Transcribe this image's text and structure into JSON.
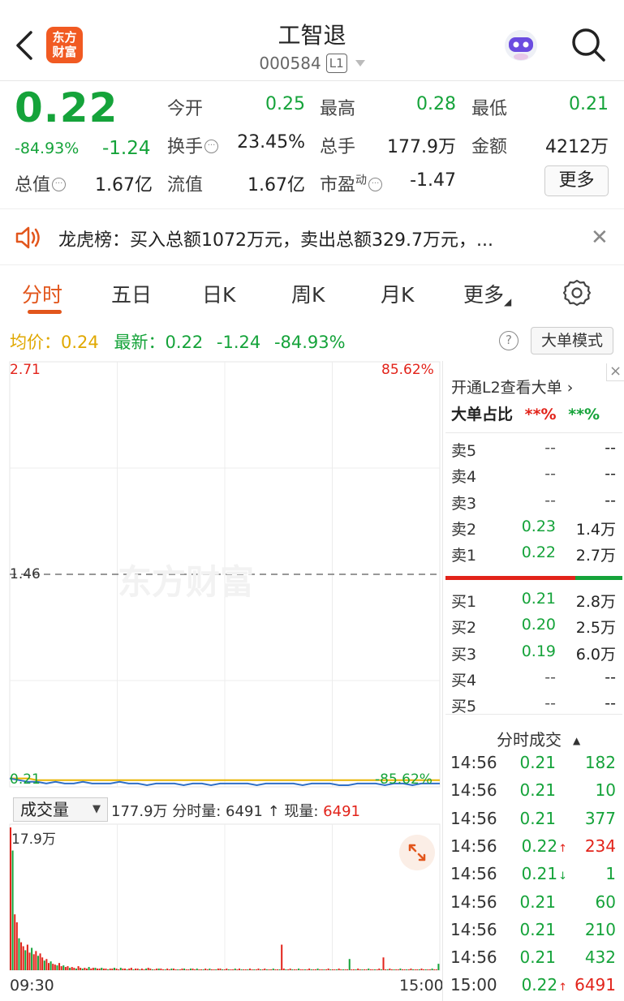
{
  "header": {
    "title": "工智退",
    "code": "000584",
    "level_badge": "L1",
    "logo_line1": "东方",
    "logo_line2": "财富"
  },
  "quote": {
    "price": "0.22",
    "pct": "-84.93%",
    "change": "-1.24",
    "fields": {
      "open_label": "今开",
      "open_value": "0.25",
      "high_label": "最高",
      "high_value": "0.28",
      "low_label": "最低",
      "low_value": "0.21",
      "turnover_label": "换手",
      "turnover_value": "23.45%",
      "volume_label": "总手",
      "volume_value": "177.9万",
      "amount_label": "金额",
      "amount_value": "4212万",
      "mktcap_label": "总值",
      "mktcap_value": "1.67亿",
      "float_label": "流值",
      "float_value": "1.67亿",
      "pe_label": "市盈",
      "pe_sup": "动",
      "pe_value": "-1.47"
    },
    "more_label": "更多"
  },
  "lhb": {
    "text": "龙虎榜：买入总额1072万元，卖出总额329.7万元，..."
  },
  "tabs": [
    "分时",
    "五日",
    "日K",
    "周K",
    "月K",
    "更多"
  ],
  "summary": {
    "avg_label": "均价：",
    "avg_value": "0.24",
    "latest_label": "最新：",
    "latest_value": "0.22",
    "latest_change": "-1.24",
    "latest_pct": "-84.93%",
    "help": "?",
    "mode_label": "大单模式"
  },
  "chart_data": {
    "type": "line",
    "y_max_label": "2.71",
    "y_mid_label": "1.46",
    "y_min_label": "0.21",
    "pct_max_label": "85.62%",
    "pct_min_label": "-85.62%",
    "x_start_label": "09:30",
    "x_end_label": "15:00",
    "ylim": [
      0.21,
      2.71
    ],
    "price": [
      0.25,
      0.24,
      0.23,
      0.23,
      0.22,
      0.23,
      0.22,
      0.22,
      0.23,
      0.22,
      0.22,
      0.22,
      0.23,
      0.22,
      0.22,
      0.21,
      0.22,
      0.22,
      0.22,
      0.21,
      0.22,
      0.22,
      0.21,
      0.22,
      0.22,
      0.22,
      0.22,
      0.21,
      0.22,
      0.22,
      0.22,
      0.22,
      0.21,
      0.22,
      0.22,
      0.22,
      0.21,
      0.21,
      0.22,
      0.22,
      0.22,
      0.21,
      0.22,
      0.22,
      0.21,
      0.22,
      0.22,
      0.22
    ],
    "avg": [
      0.25,
      0.25,
      0.25,
      0.24,
      0.24,
      0.24,
      0.24,
      0.24,
      0.24,
      0.24,
      0.24,
      0.24,
      0.24,
      0.24,
      0.24,
      0.24,
      0.24,
      0.24,
      0.24,
      0.24,
      0.24,
      0.24,
      0.24,
      0.24,
      0.24,
      0.24,
      0.24,
      0.24,
      0.24,
      0.24,
      0.24,
      0.24,
      0.24,
      0.24,
      0.24,
      0.24,
      0.24,
      0.24,
      0.24,
      0.24,
      0.24,
      0.24,
      0.24,
      0.24,
      0.24,
      0.24,
      0.24,
      0.24
    ],
    "volume_max_label": "17.9万",
    "volume": [
      17.9,
      15,
      7,
      6,
      4,
      3.5,
      3,
      2.5,
      3.2,
      2.2,
      2.8,
      2,
      2.4,
      1.8,
      2.1,
      1.6,
      1.2,
      1.4,
      0.9,
      1.1,
      0.8,
      0.7,
      0.6,
      0.9,
      0.5,
      0.6,
      0.4,
      0.5,
      0.3,
      0.4,
      0.3,
      0.2,
      0.5,
      0.3,
      0.2,
      0.3,
      0.2,
      0.4,
      0.2,
      0.3,
      0.3,
      0.2,
      0.2,
      0.3,
      0.2,
      0.2,
      0.1,
      0.2,
      0.2,
      0.3,
      0.2,
      0.1,
      0.3,
      0.2,
      0.2,
      0.1,
      0.2,
      0.3,
      0.1,
      0.2,
      0.2,
      0.1,
      0.2,
      0.1,
      0.2,
      0.3,
      0.2,
      0.1,
      0.1,
      0.2,
      0.2,
      0.2,
      0.1,
      0.1,
      0.2,
      0.1,
      0.2,
      0.2,
      0.1,
      0.1,
      0.1,
      0.2,
      0.2,
      0.1,
      0.1,
      0.2,
      0.2,
      0.1,
      0.2,
      0.1,
      0.1,
      0.1,
      0.2,
      0.1,
      0.2,
      0.1,
      0.1,
      0.1,
      0.2,
      0.2,
      0.1,
      0.1,
      0.2,
      0.1,
      0.1,
      0.1,
      0.2,
      0.1,
      0.2,
      0.1,
      0.1,
      0.1,
      0.1,
      0.2,
      0.1,
      0.1,
      0.1,
      0.2,
      0.1,
      0.1,
      0.2,
      0.1,
      0.1,
      0.1,
      0.2,
      0.1,
      0.1,
      0.1,
      3.2,
      0.2,
      0.1,
      0.1,
      0.2,
      0.1,
      0.1,
      0.1,
      0.2,
      0.1,
      0.1,
      0.1,
      0.1,
      0.2,
      0.1,
      0.1,
      0.1,
      0.2,
      0.1,
      0.1,
      0.1,
      0.1,
      0.2,
      0.1,
      0.1,
      0.1,
      0.1,
      0.2,
      0.1,
      0.1,
      0.1,
      0.1,
      1.4,
      0.1,
      0.1,
      0.1,
      0.2,
      0.1,
      0.1,
      0.1,
      0.1,
      0.2,
      0.1,
      0.1,
      0.1,
      0.1,
      0.2,
      0.1,
      1.6,
      0.1,
      0.1,
      0.2,
      0.1,
      0.1,
      0.1,
      0.1,
      0.2,
      0.1,
      0.1,
      0.1,
      0.1,
      0.2,
      0.1,
      0.1,
      0.1,
      0.1,
      0.2,
      0.1,
      0.1,
      0.1,
      0.1,
      0.2,
      0.1,
      0.1,
      0.8
    ]
  },
  "volume_header": {
    "select_label": "成交量",
    "info_total": "177.9万",
    "info_text": " 分时量: 6491 ↑ 现量: ",
    "info_now": "6491"
  },
  "panel": {
    "l2_link": "开通L2查看大单 ›",
    "big_ratio_label": "大单占比",
    "big_ratio_red": "**%",
    "big_ratio_green": "**%",
    "close": "×",
    "asks": [
      {
        "label": "卖5",
        "price": "--",
        "vol": "--"
      },
      {
        "label": "卖4",
        "price": "--",
        "vol": "--"
      },
      {
        "label": "卖3",
        "price": "--",
        "vol": "--"
      },
      {
        "label": "卖2",
        "price": "0.23",
        "vol": "1.4万"
      },
      {
        "label": "卖1",
        "price": "0.22",
        "vol": "2.7万"
      }
    ],
    "bids": [
      {
        "label": "买1",
        "price": "0.21",
        "vol": "2.8万"
      },
      {
        "label": "买2",
        "price": "0.20",
        "vol": "2.5万"
      },
      {
        "label": "买3",
        "price": "0.19",
        "vol": "6.0万"
      },
      {
        "label": "买4",
        "price": "--",
        "vol": "--"
      },
      {
        "label": "买5",
        "price": "--",
        "vol": "--"
      }
    ],
    "ticks_title": "分时成交",
    "ticks": [
      {
        "time": "14:56",
        "price": "0.21",
        "vol": "182",
        "dir": "",
        "pcolor": "green",
        "vcolor": "green"
      },
      {
        "time": "14:56",
        "price": "0.21",
        "vol": "10",
        "dir": "",
        "pcolor": "green",
        "vcolor": "green"
      },
      {
        "time": "14:56",
        "price": "0.21",
        "vol": "377",
        "dir": "",
        "pcolor": "green",
        "vcolor": "green"
      },
      {
        "time": "14:56",
        "price": "0.22",
        "vol": "234",
        "dir": "↑",
        "pcolor": "green",
        "vcolor": "red"
      },
      {
        "time": "14:56",
        "price": "0.21",
        "vol": "1",
        "dir": "↓",
        "pcolor": "green",
        "vcolor": "green"
      },
      {
        "time": "14:56",
        "price": "0.21",
        "vol": "60",
        "dir": "",
        "pcolor": "green",
        "vcolor": "green"
      },
      {
        "time": "14:56",
        "price": "0.21",
        "vol": "210",
        "dir": "",
        "pcolor": "green",
        "vcolor": "green"
      },
      {
        "time": "14:56",
        "price": "0.21",
        "vol": "432",
        "dir": "",
        "pcolor": "green",
        "vcolor": "green"
      },
      {
        "time": "15:00",
        "price": "0.22",
        "vol": "6491",
        "dir": "↑",
        "pcolor": "green",
        "vcolor": "red"
      }
    ]
  },
  "colors": {
    "up": "#e2231a",
    "down": "#15a33a",
    "accent": "#e2561c",
    "avg_line": "#e8b400",
    "price_line": "#2f6fc7"
  }
}
